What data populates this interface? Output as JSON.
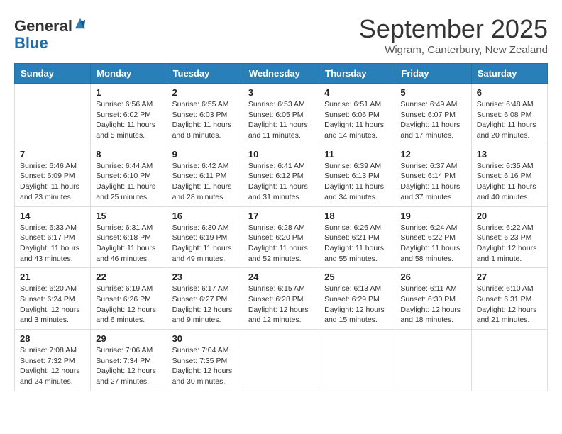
{
  "header": {
    "logo_line1": "General",
    "logo_line2": "Blue",
    "month": "September 2025",
    "location": "Wigram, Canterbury, New Zealand"
  },
  "days_of_week": [
    "Sunday",
    "Monday",
    "Tuesday",
    "Wednesday",
    "Thursday",
    "Friday",
    "Saturday"
  ],
  "weeks": [
    [
      {
        "day": "",
        "info": ""
      },
      {
        "day": "1",
        "info": "Sunrise: 6:56 AM\nSunset: 6:02 PM\nDaylight: 11 hours\nand 5 minutes."
      },
      {
        "day": "2",
        "info": "Sunrise: 6:55 AM\nSunset: 6:03 PM\nDaylight: 11 hours\nand 8 minutes."
      },
      {
        "day": "3",
        "info": "Sunrise: 6:53 AM\nSunset: 6:05 PM\nDaylight: 11 hours\nand 11 minutes."
      },
      {
        "day": "4",
        "info": "Sunrise: 6:51 AM\nSunset: 6:06 PM\nDaylight: 11 hours\nand 14 minutes."
      },
      {
        "day": "5",
        "info": "Sunrise: 6:49 AM\nSunset: 6:07 PM\nDaylight: 11 hours\nand 17 minutes."
      },
      {
        "day": "6",
        "info": "Sunrise: 6:48 AM\nSunset: 6:08 PM\nDaylight: 11 hours\nand 20 minutes."
      }
    ],
    [
      {
        "day": "7",
        "info": "Sunrise: 6:46 AM\nSunset: 6:09 PM\nDaylight: 11 hours\nand 23 minutes."
      },
      {
        "day": "8",
        "info": "Sunrise: 6:44 AM\nSunset: 6:10 PM\nDaylight: 11 hours\nand 25 minutes."
      },
      {
        "day": "9",
        "info": "Sunrise: 6:42 AM\nSunset: 6:11 PM\nDaylight: 11 hours\nand 28 minutes."
      },
      {
        "day": "10",
        "info": "Sunrise: 6:41 AM\nSunset: 6:12 PM\nDaylight: 11 hours\nand 31 minutes."
      },
      {
        "day": "11",
        "info": "Sunrise: 6:39 AM\nSunset: 6:13 PM\nDaylight: 11 hours\nand 34 minutes."
      },
      {
        "day": "12",
        "info": "Sunrise: 6:37 AM\nSunset: 6:14 PM\nDaylight: 11 hours\nand 37 minutes."
      },
      {
        "day": "13",
        "info": "Sunrise: 6:35 AM\nSunset: 6:16 PM\nDaylight: 11 hours\nand 40 minutes."
      }
    ],
    [
      {
        "day": "14",
        "info": "Sunrise: 6:33 AM\nSunset: 6:17 PM\nDaylight: 11 hours\nand 43 minutes."
      },
      {
        "day": "15",
        "info": "Sunrise: 6:31 AM\nSunset: 6:18 PM\nDaylight: 11 hours\nand 46 minutes."
      },
      {
        "day": "16",
        "info": "Sunrise: 6:30 AM\nSunset: 6:19 PM\nDaylight: 11 hours\nand 49 minutes."
      },
      {
        "day": "17",
        "info": "Sunrise: 6:28 AM\nSunset: 6:20 PM\nDaylight: 11 hours\nand 52 minutes."
      },
      {
        "day": "18",
        "info": "Sunrise: 6:26 AM\nSunset: 6:21 PM\nDaylight: 11 hours\nand 55 minutes."
      },
      {
        "day": "19",
        "info": "Sunrise: 6:24 AM\nSunset: 6:22 PM\nDaylight: 11 hours\nand 58 minutes."
      },
      {
        "day": "20",
        "info": "Sunrise: 6:22 AM\nSunset: 6:23 PM\nDaylight: 12 hours\nand 1 minute."
      }
    ],
    [
      {
        "day": "21",
        "info": "Sunrise: 6:20 AM\nSunset: 6:24 PM\nDaylight: 12 hours\nand 3 minutes."
      },
      {
        "day": "22",
        "info": "Sunrise: 6:19 AM\nSunset: 6:26 PM\nDaylight: 12 hours\nand 6 minutes."
      },
      {
        "day": "23",
        "info": "Sunrise: 6:17 AM\nSunset: 6:27 PM\nDaylight: 12 hours\nand 9 minutes."
      },
      {
        "day": "24",
        "info": "Sunrise: 6:15 AM\nSunset: 6:28 PM\nDaylight: 12 hours\nand 12 minutes."
      },
      {
        "day": "25",
        "info": "Sunrise: 6:13 AM\nSunset: 6:29 PM\nDaylight: 12 hours\nand 15 minutes."
      },
      {
        "day": "26",
        "info": "Sunrise: 6:11 AM\nSunset: 6:30 PM\nDaylight: 12 hours\nand 18 minutes."
      },
      {
        "day": "27",
        "info": "Sunrise: 6:10 AM\nSunset: 6:31 PM\nDaylight: 12 hours\nand 21 minutes."
      }
    ],
    [
      {
        "day": "28",
        "info": "Sunrise: 7:08 AM\nSunset: 7:32 PM\nDaylight: 12 hours\nand 24 minutes."
      },
      {
        "day": "29",
        "info": "Sunrise: 7:06 AM\nSunset: 7:34 PM\nDaylight: 12 hours\nand 27 minutes."
      },
      {
        "day": "30",
        "info": "Sunrise: 7:04 AM\nSunset: 7:35 PM\nDaylight: 12 hours\nand 30 minutes."
      },
      {
        "day": "",
        "info": ""
      },
      {
        "day": "",
        "info": ""
      },
      {
        "day": "",
        "info": ""
      },
      {
        "day": "",
        "info": ""
      }
    ]
  ]
}
